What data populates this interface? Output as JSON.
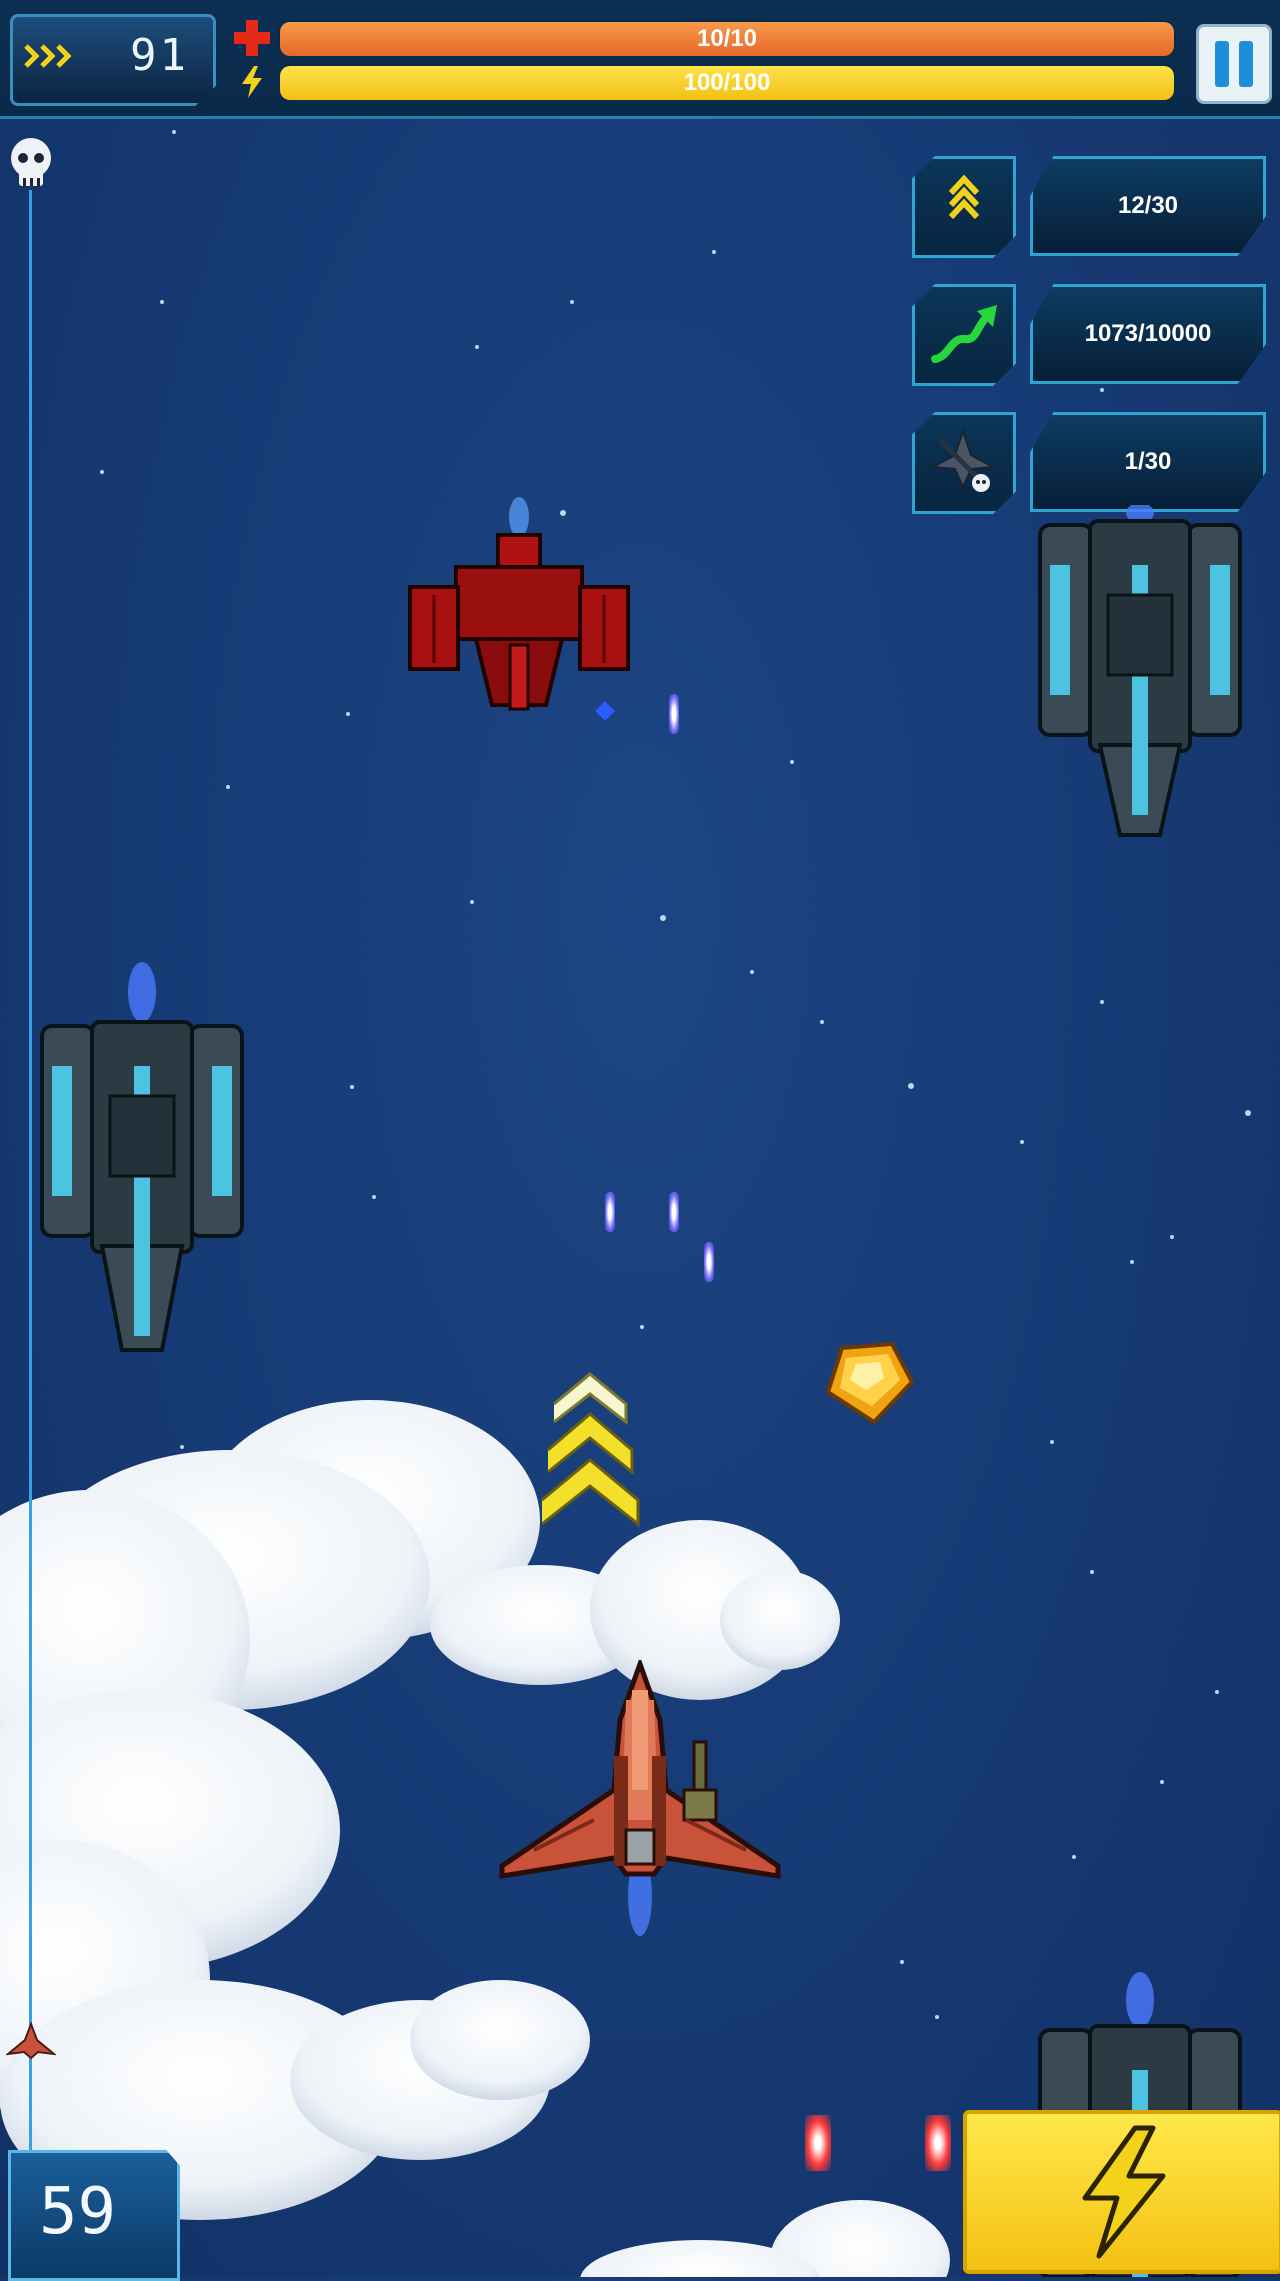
{
  "hud": {
    "speed_value": "91",
    "health": {
      "value": 10,
      "max": 10,
      "label": "10/10"
    },
    "energy": {
      "value": 100,
      "max": 100,
      "label": "100/100"
    },
    "pause_icon": "pause-icon",
    "colors": {
      "health": "#e6682a",
      "energy": "#f3c112",
      "accent": "#2fa5d4"
    }
  },
  "missions": [
    {
      "icon": "rank-chevrons-icon",
      "progress": "12/30"
    },
    {
      "icon": "growth-arrow-icon",
      "progress": "1073/10000"
    },
    {
      "icon": "destroyed-ship-icon",
      "progress": "1/30"
    }
  ],
  "level_progress": {
    "start_icon": "skull-icon",
    "marker_icon": "player-ship-marker-icon"
  },
  "kill_counter": "59",
  "special_button": {
    "icon": "lightning-icon"
  },
  "scene": {
    "player": "player-fighter-ship",
    "enemies": [
      "red-gunship",
      "teal-cruiser",
      "teal-cruiser",
      "teal-cruiser"
    ],
    "pickups": [
      "rank-up-chevrons",
      "gold-gem"
    ]
  }
}
